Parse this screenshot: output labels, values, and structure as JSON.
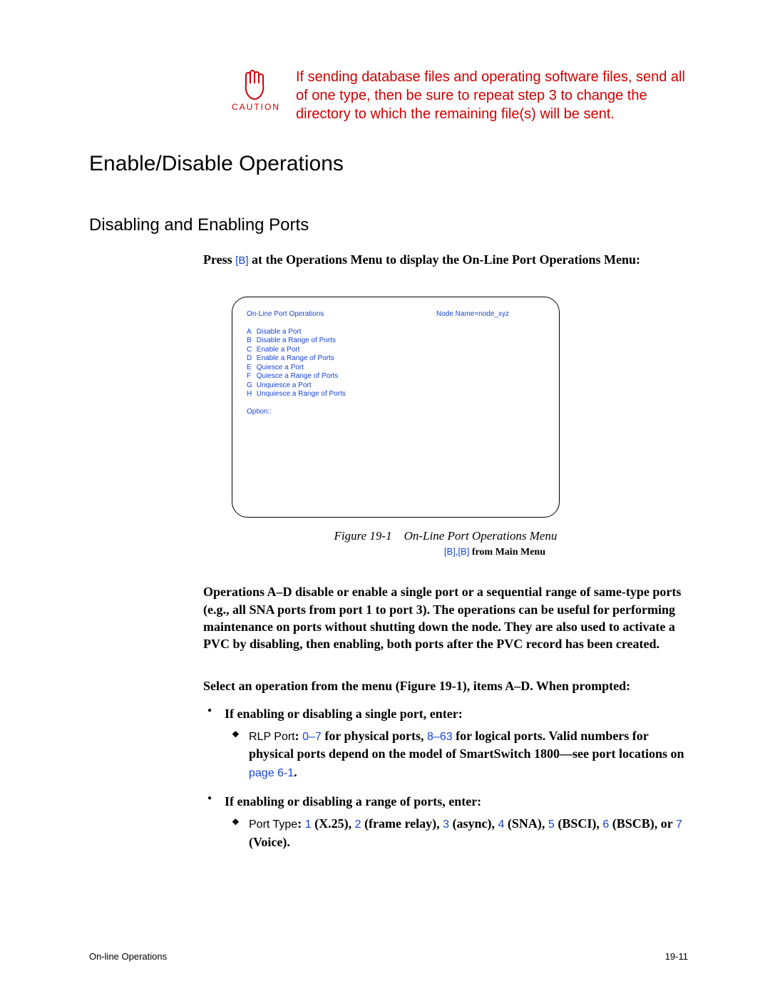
{
  "caution": {
    "label": "CAUTION",
    "text": "If sending database files and operating software files, send all of one type, then be sure to repeat step 3 to change the directory to which the remaining file(s) will be sent."
  },
  "h1": "Enable/Disable Operations",
  "h2": "Disabling and Enabling Ports",
  "intro": {
    "pre": "Press ",
    "key": "[B]",
    "post": " at the Operations Menu to display the On-Line Port Operations Menu:"
  },
  "screen": {
    "node": "Node Name=node_xyz",
    "title": "On-Line Port Operations",
    "items": [
      {
        "k": "A",
        "t": "Disable a Port"
      },
      {
        "k": "B",
        "t": "Disable a Range of Ports"
      },
      {
        "k": "C",
        "t": "Enable a Port"
      },
      {
        "k": "D",
        "t": "Enable a Range of Ports"
      },
      {
        "k": "E",
        "t": "Quiesce a Port"
      },
      {
        "k": "F",
        "t": "Quiesce a Range of Ports"
      },
      {
        "k": "G",
        "t": "Unquiesce a Port"
      },
      {
        "k": "H",
        "t": "Unquiesce a Range of Ports"
      }
    ],
    "option": "Option::"
  },
  "figcap": "Figure 19-1 On-Line Port Operations Menu",
  "figpath": {
    "keys": "[B],[B]",
    "rest": " from Main Menu"
  },
  "para1": "Operations A–D disable or enable a single port or a sequential range of same-type ports (e.g., all SNA ports from port 1 to port 3). The operations can be useful for performing maintenance on ports without shutting down the node. They are also used to activate a PVC by disabling, then enabling, both ports after the PVC record has been created.",
  "para2": "Select an operation from the menu (Figure 19-1), items A–D. When prompted:",
  "b1": "If enabling or disabling a single port, enter:",
  "b1a": {
    "field": "RLP Port",
    "colon": ": ",
    "r1": "0–7",
    "t1": " for physical ports, ",
    "r2": "8–63",
    "t2": " for logical ports. Valid numbers for physical ports depend on the model of SmartSwitch 1800—see port locations on ",
    "link": "page 6-1",
    "end": "."
  },
  "b2": "If enabling or disabling a range of ports, enter:",
  "b2a": {
    "field": "Port Type",
    "colon": ": ",
    "parts": [
      {
        "v": "1",
        "t": " (X.25), "
      },
      {
        "v": "2",
        "t": " (frame relay), "
      },
      {
        "v": "3",
        "t": " (async), "
      },
      {
        "v": "4",
        "t": " (SNA), "
      },
      {
        "v": "5",
        "t": " (BSCI), "
      },
      {
        "v": "6",
        "t": " (BSCB), or "
      },
      {
        "v": "7",
        "t": " (Voice)."
      }
    ]
  },
  "footer": {
    "left": "On-line Operations",
    "right": "19-11"
  }
}
